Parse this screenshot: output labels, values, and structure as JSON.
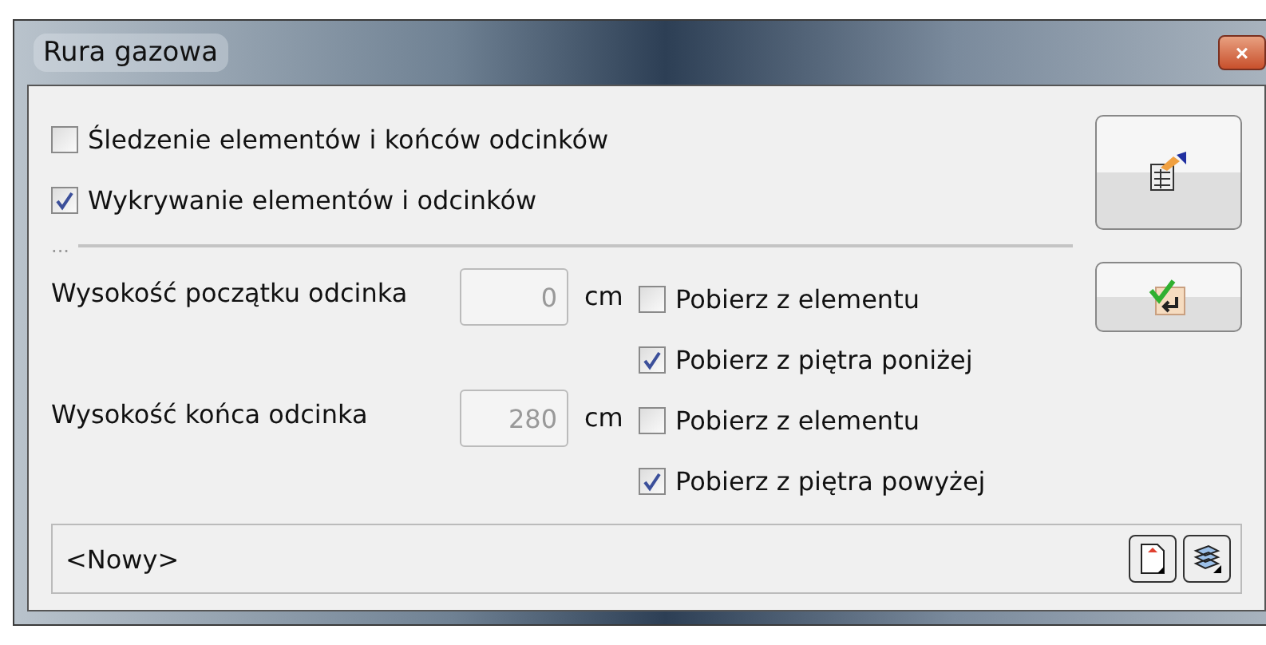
{
  "window": {
    "title": "Rura gazowa",
    "close": "×"
  },
  "options": [
    {
      "label": "Śledzenie elementów i końców odcinków",
      "checked": false
    },
    {
      "label": "Wykrywanie elementów i odcinków",
      "checked": true
    }
  ],
  "separator": "...",
  "heights": [
    {
      "label": "Wysokość początku odcinka",
      "value": "0",
      "unit": "cm",
      "sources": [
        {
          "label": "Pobierz z elementu",
          "checked": false
        },
        {
          "label": "Pobierz z piętra poniżej",
          "checked": true
        }
      ]
    },
    {
      "label": "Wysokość końca odcinka",
      "value": "280",
      "unit": "cm",
      "sources": [
        {
          "label": "Pobierz z elementu",
          "checked": false
        },
        {
          "label": "Pobierz z piętra powyżej",
          "checked": true
        }
      ]
    }
  ],
  "status": {
    "value": "<Nowy>"
  }
}
